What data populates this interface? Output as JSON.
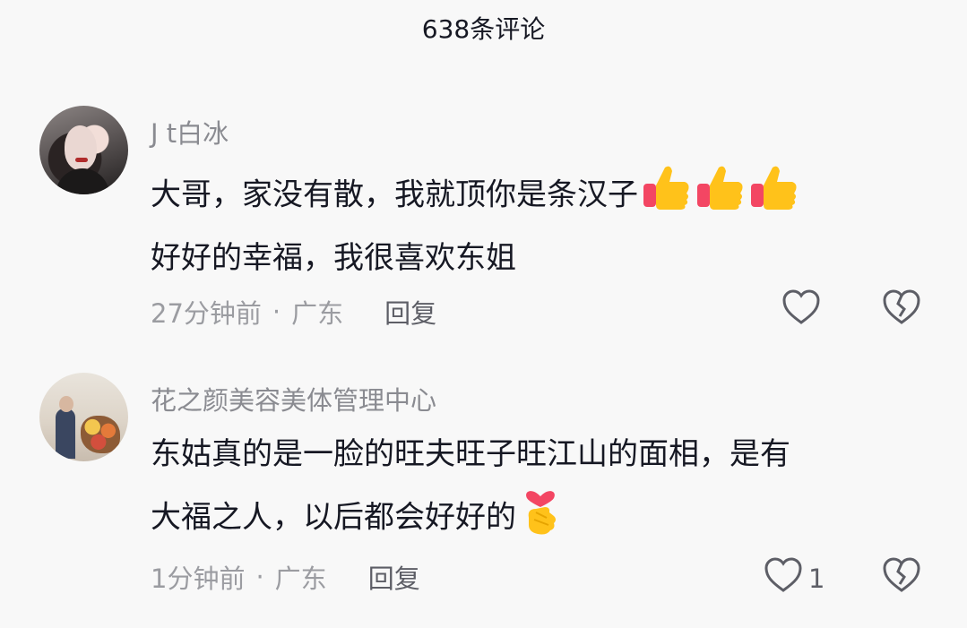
{
  "header": {
    "title": "638条评论"
  },
  "comments": [
    {
      "username": "J t白冰",
      "line1": "大哥，家没有散，我就顶你是条汉子",
      "line2": "好好的幸福，我很喜欢东姐",
      "time": "27分钟前",
      "location": "广东",
      "reply": "回复",
      "like_count": "",
      "emojis": [
        "thumbs-up",
        "thumbs-up",
        "thumbs-up"
      ]
    },
    {
      "username": "花之颜美容美体管理中心",
      "line1": "东姑真的是一脸的旺夫旺子旺江山的面相，是有",
      "line2": "大福之人，以后都会好好的",
      "time": "1分钟前",
      "location": "广东",
      "reply": "回复",
      "like_count": "1",
      "emojis": [
        "finger-heart"
      ]
    }
  ],
  "separator": "·"
}
